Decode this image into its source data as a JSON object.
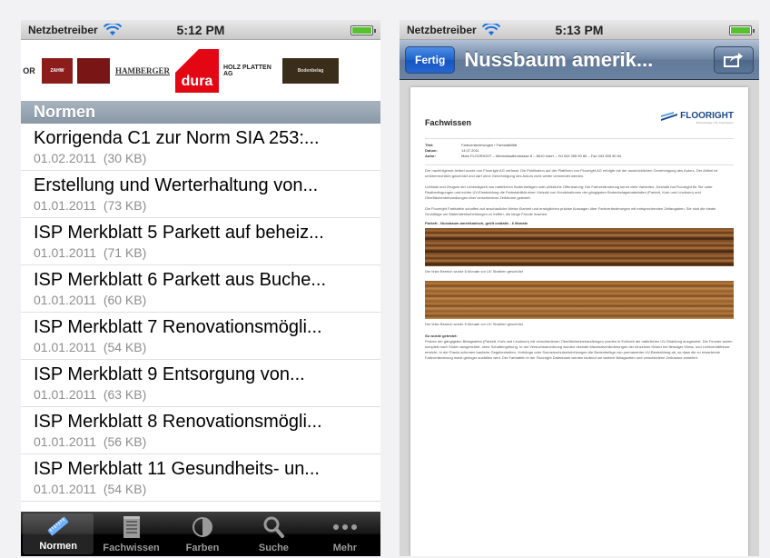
{
  "left": {
    "status": {
      "carrier": "Netzbetreiber",
      "time": "5:12 PM"
    },
    "logos": [
      {
        "text": "OR"
      },
      {
        "text": "ZAHW"
      },
      {
        "text": ""
      },
      {
        "text": "HAMBERGER"
      },
      {
        "text": "dura"
      },
      {
        "text": "HOLZ PLATTEN AG"
      },
      {
        "text": "Bodenbelag"
      },
      {
        "text": ""
      }
    ],
    "section_header": "Normen",
    "items": [
      {
        "title": "Korrigenda C1 zur Norm SIA 253:...",
        "date": "01.02.2011",
        "size": "(30 KB)"
      },
      {
        "title": "Erstellung und Werterhaltung von...",
        "date": "01.01.2011",
        "size": "(73 KB)"
      },
      {
        "title": "ISP Merkblatt 5 Parkett auf beheiz...",
        "date": "01.01.2011",
        "size": "(71 KB)"
      },
      {
        "title": "ISP Merkblatt 6 Parkett aus Buche...",
        "date": "01.01.2011",
        "size": "(60 KB)"
      },
      {
        "title": "ISP Merkblatt 7 Renovationsmögli...",
        "date": "01.01.2011",
        "size": "(54 KB)"
      },
      {
        "title": "ISP Merkblatt 9 Entsorgung von...",
        "date": "01.01.2011",
        "size": "(63 KB)"
      },
      {
        "title": "ISP Merkblatt 8 Renovationsmögli...",
        "date": "01.01.2011",
        "size": "(56 KB)"
      },
      {
        "title": "ISP Merkblatt 11 Gesundheits- un...",
        "date": "01.01.2011",
        "size": "(54 KB)"
      }
    ],
    "tabs": [
      {
        "label": "Normen",
        "icon": "ruler-icon"
      },
      {
        "label": "Fachwissen",
        "icon": "notepad-icon"
      },
      {
        "label": "Farben",
        "icon": "color-circle-icon"
      },
      {
        "label": "Suche",
        "icon": "search-icon"
      },
      {
        "label": "Mehr",
        "icon": "more-dots-icon"
      }
    ]
  },
  "right": {
    "status": {
      "carrier": "Netzbetreiber",
      "time": "5:13 PM"
    },
    "nav": {
      "back_label": "Fertig",
      "title": "Nussbaum amerik..."
    },
    "doc": {
      "heading": "Fachwissen",
      "brand": "FLOORIGHT",
      "brand_sub": "Bodenbeläge | Öl | Fachwissen",
      "meta": [
        {
          "k": "Titel:",
          "v": "Farbveränderungen / Farbstabilität"
        },
        {
          "k": "Datum:",
          "v": "14.07.2011"
        },
        {
          "k": "Autor:",
          "v": "Mars FLOORIGHT – Wermatswilerstrasse 8 – 8610 Uster – Tel 043 355 90 80 – Fax 043 355 90 84"
        }
      ],
      "intro": "Der nachfolgende Artikel wurde von Floorright AG verfasst. Die Publikation auf der Plattform von Floorright AG erfolgte mit der ausdrücklichen Genehmigung des Autors. Der Artikel ist urheberrechtlich geschützt und darf ohne Genehmigung des Autors nicht weiter verwendet werden.",
      "p1": "Lichttakt und Zeugnis der Lebendigkeit von natürlichen Bodenbelägen oder plötzliche Offenbarung: Die Farbveränderung kennt viele Varianten. Deshalb hat Floorright für Sie unter Realbedingungen und echter UV-Einstrahlung die Farbstabilität einer Vielzahl von Kombinationen der gängigsten Bodenbelagsmaterialien (Parkett, Kork und Linoleum) und Oberflächenbehandlungen über verschiedene Zeiträume getestet.",
      "p2": "Die Floorright Farbtafeln schaffen auf anschauliche Weise Klarheit und ermöglichen präzise Aussagen über Farbveränderungen mit entsprechenden Zeitangaben. Sie sind die ideale Grundlage um Materialentscheidungen zu treffen, die lange Freude machen.",
      "caption": "Parkett - Nussbaum amerikanisch, geölt oxidativ - 6 Monate",
      "note1": "Der linke Bereich wurde 6 Monate vor UV Strahlen geschützt",
      "note2": "Der linke Bereich wurde 6 Monate vor UV Strahlen geschützt",
      "tested_head": "So wurde getestet:",
      "p3": "Proben der gängigsten Belagsarten (Parkett, Kork und Linoleum) mit verschiedenen Oberflächenbehandlungen wurden in Echtzeit der natürlichen UV-Strahlung ausgesetzt. Die Fenster waren komplett nach Süden ausgerichtet, ohne Schattengebung. In der Versuchsanordnung wurden deshalb Maximalveränderungen der einzelnen Hölzer bei fleissiger Klima- und Lichtverhältnisse erreicht. In der Praxis schirmen bauliche Gegebenheiten, Vorhänge oder Sonnenschutzeinrichtungen die Bodenbeläge von permanenter UV-Bestrahlung ab, so dass die zu erwartende Farbveränderung meist geringer ausfallen wird. Der Farbtafeln in der Floorright Datenbank werden laufend um weitere Belagsarten und verschiedene Zeiträume erweitert."
    }
  },
  "colors": {
    "nav_blue": "#6d84a2",
    "button_blue": "#1c62c9",
    "section_gray": "#8a98a6",
    "tab_black": "#000000"
  }
}
